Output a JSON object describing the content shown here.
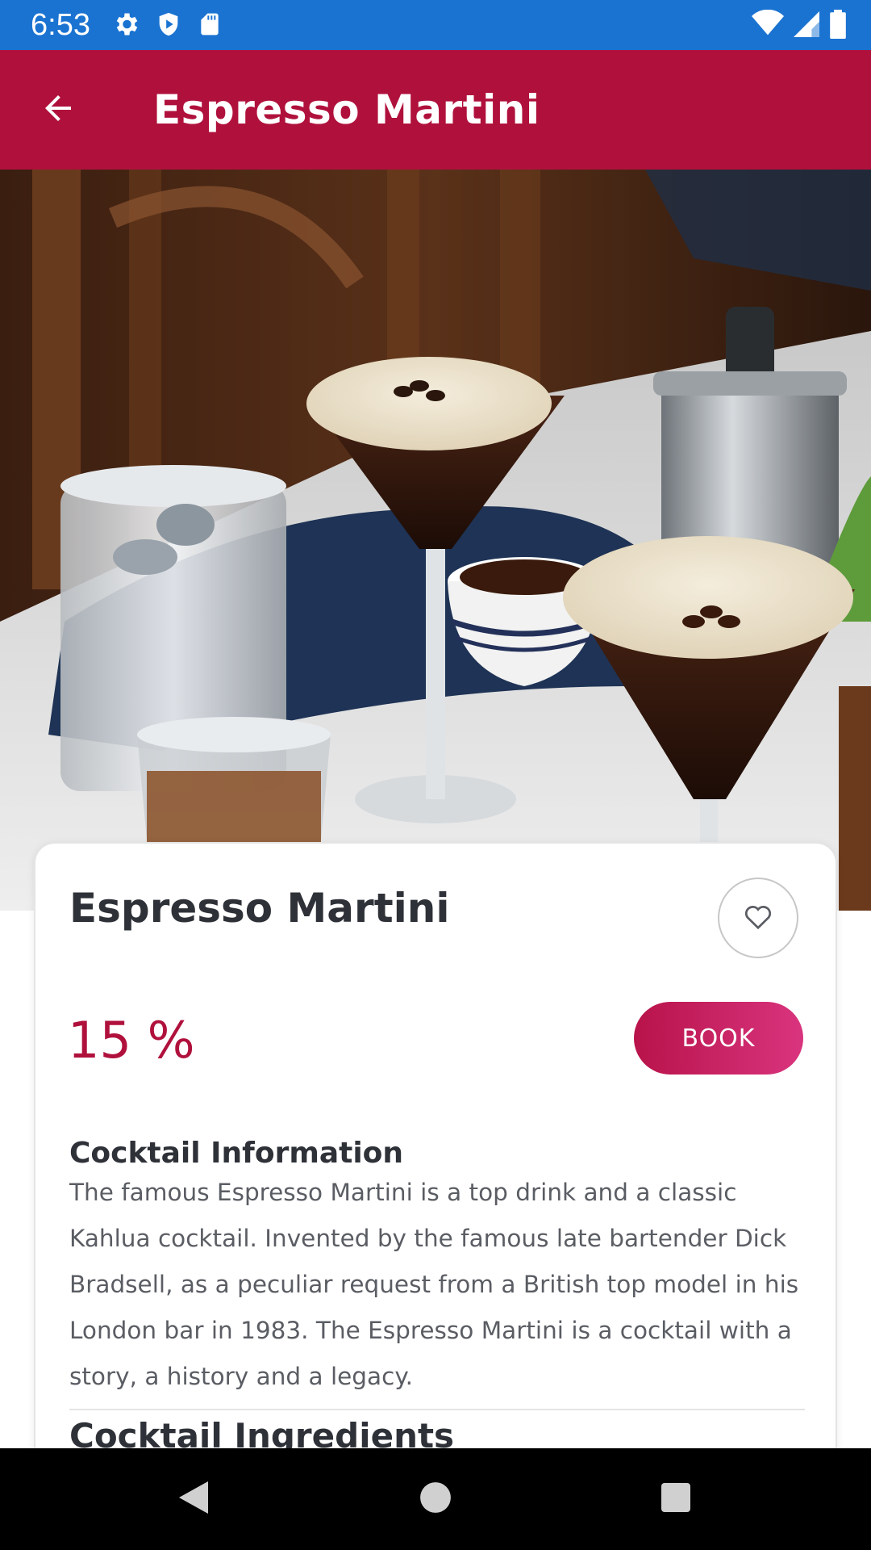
{
  "status_bar": {
    "time": "6:53",
    "left_icons": [
      "gear-icon",
      "shield-play-icon",
      "sd-card-icon"
    ],
    "right_icons": [
      "wifi-icon",
      "signal-icon",
      "battery-icon"
    ]
  },
  "app_bar": {
    "title": "Espresso Martini",
    "back_icon": "arrow-back-icon",
    "color": "#b0113c"
  },
  "hero": {
    "image": "espresso-martini-photo",
    "carousel_pages": 1,
    "active_page": 1
  },
  "detail": {
    "name": "Espresso Martini",
    "favorite_icon": "heart-outline-icon",
    "price": "15 %",
    "book_label": "BOOK",
    "info_heading": "Cocktail Information",
    "info_text": "The famous Espresso Martini is a top drink and a classic Kahlua cocktail. Invented by the famous late bartender Dick Bradsell, as a peculiar request from a British top model in his London bar in 1983. The Espresso Martini is a cocktail with a story, a history and a legacy.",
    "ingredients_heading": "Cocktail Ingredients"
  },
  "nav_bar": {
    "icons": [
      "nav-back-icon",
      "nav-home-icon",
      "nav-recents-icon"
    ]
  },
  "colors": {
    "status_bar": "#1a73d1",
    "accent": "#b0113c",
    "book_gradient_end": "#d9347e",
    "text_dark": "#2e3137",
    "text_body": "#5a5d63"
  }
}
